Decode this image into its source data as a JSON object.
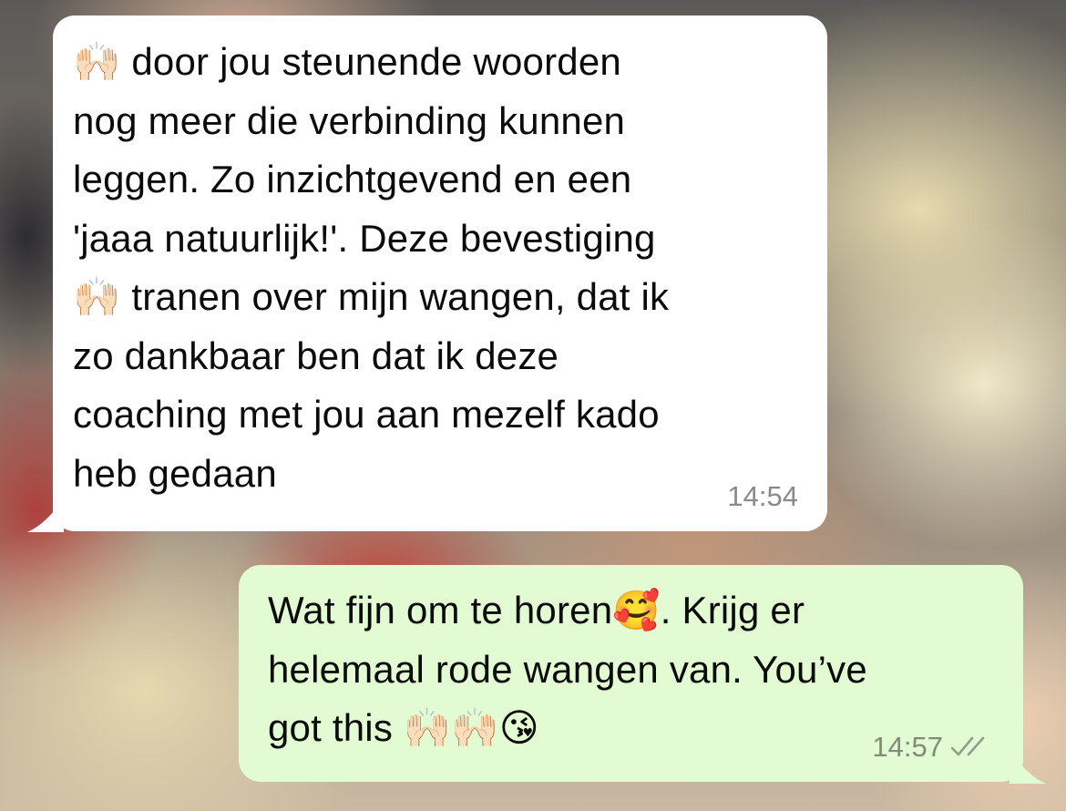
{
  "messages": [
    {
      "direction": "incoming",
      "text": "🙌🏻 door jou steunende woorden\nnog meer die verbinding kunnen\nleggen. Zo inzichtgevend en een\n'jaaa natuurlijk!'. Deze bevestiging\n🙌🏻 tranen over mijn wangen, dat ik\nzo dankbaar ben dat ik deze\ncoaching met jou aan mezelf kado\nheb gedaan",
      "time": "14:54"
    },
    {
      "direction": "outgoing",
      "text": "Wat fijn om te horen🥰. Krijg er\nhelemaal rode wangen van. You’ve\ngot this 🙌🏻🙌🏻😘",
      "time": "14:57",
      "status_icon": "double-check-icon"
    }
  ],
  "colors": {
    "incoming_bubble": "#ffffff",
    "outgoing_bubble": "#e2fbd3",
    "timestamp": "#8a8a8a"
  }
}
